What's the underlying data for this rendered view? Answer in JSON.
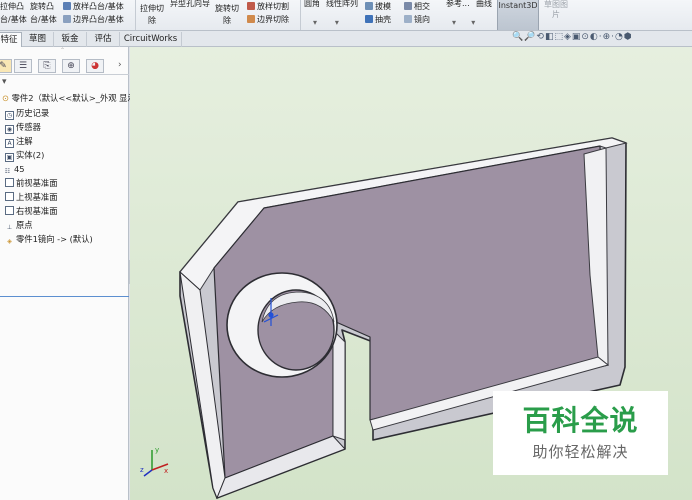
{
  "ribbon": {
    "items": [
      {
        "label": "拉伸凸"
      },
      {
        "label": "台/基体"
      },
      {
        "label": "旋转凸"
      },
      {
        "label": "台/基体"
      },
      {
        "label": "放样凸台/基体"
      },
      {
        "label": "边界凸台/基体"
      },
      {
        "label": "拉伸切"
      },
      {
        "label": "除"
      },
      {
        "label": "异型孔向导"
      },
      {
        "label": "旋转切"
      },
      {
        "label": "除"
      },
      {
        "label": "放样切割"
      },
      {
        "label": "边界切除"
      },
      {
        "label": "圆角"
      },
      {
        "label": "线性阵列"
      },
      {
        "label": "拔模"
      },
      {
        "label": "相交"
      },
      {
        "label": "抽壳"
      },
      {
        "label": "镜向"
      },
      {
        "label": "参考..."
      },
      {
        "label": "曲线"
      }
    ],
    "instant3d": "Instant3D",
    "sketch_picture": [
      "草图图",
      "片"
    ]
  },
  "tabs": [
    {
      "label": "特征"
    },
    {
      "label": "草图"
    },
    {
      "label": "钣金"
    },
    {
      "label": "评估"
    },
    {
      "label": "CircuitWorks"
    }
  ],
  "heads_up_toolbar": "🔍🔎⟲◧⬚◈▣⊙◐·⊕·◔⬢",
  "feature_tree": {
    "root": "零件2（默认<<默认>_外观 显示",
    "items": [
      {
        "label": "历史记录",
        "icon": "history-icon"
      },
      {
        "label": "传感器",
        "icon": "sensor-icon"
      },
      {
        "label": "注解",
        "icon": "annotation-icon"
      },
      {
        "label": "实体(2)",
        "icon": "solid-bodies-icon"
      },
      {
        "label": "45",
        "icon": "material-icon"
      },
      {
        "label": "前视基准面",
        "icon": "plane-icon"
      },
      {
        "label": "上视基准面",
        "icon": "plane-icon"
      },
      {
        "label": "右视基准面",
        "icon": "plane-icon"
      },
      {
        "label": "原点",
        "icon": "origin-icon"
      },
      {
        "label": "零件1镜向 -> (默认)",
        "icon": "mirror-part-icon"
      }
    ]
  },
  "axis": {
    "x": "x",
    "y": "y",
    "z": "z"
  },
  "colors": {
    "viewport_top": "#e6efdf",
    "viewport_bottom": "#d3e3c9",
    "part_face": "#9e91a3",
    "wall_light": "#f2f2f4",
    "watermark_green": "#2a9d4a"
  },
  "watermark": {
    "title": "百科全说",
    "subtitle": "助你轻松解决"
  }
}
